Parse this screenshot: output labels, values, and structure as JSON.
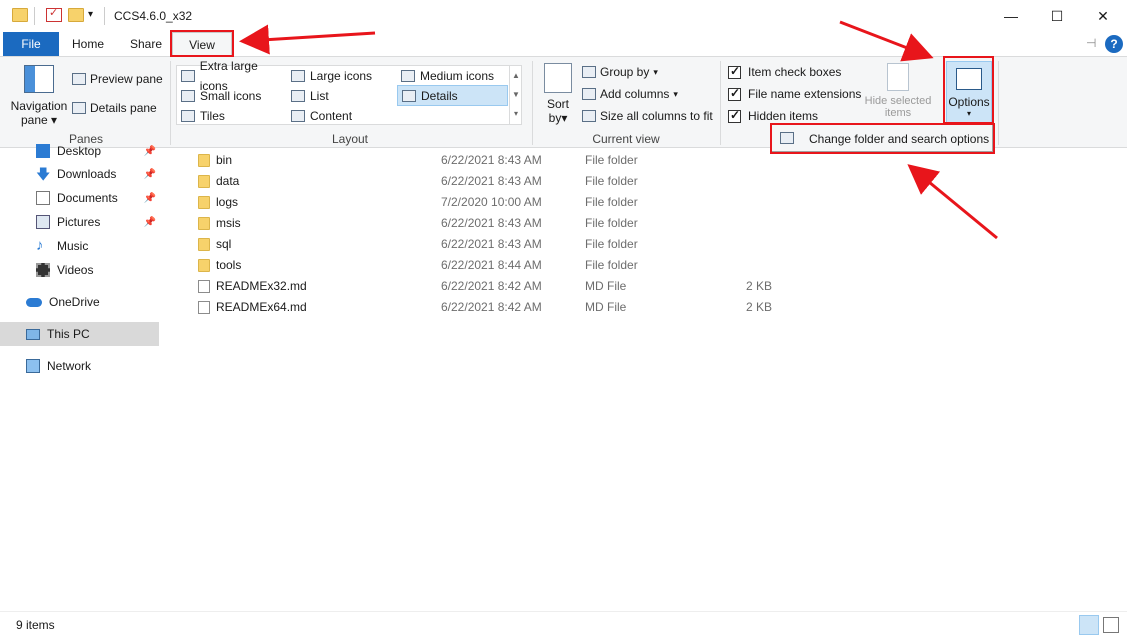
{
  "window": {
    "title": "CCS4.6.0_x32",
    "controls": {
      "minimize": "—",
      "maximize": "☐",
      "close": "✕"
    }
  },
  "tabs": {
    "file": "File",
    "home": "Home",
    "share": "Share",
    "view": "View"
  },
  "ribbon": {
    "panes": {
      "label": "Panes",
      "navigation_pane": "Navigation",
      "navigation_pane_line2": "pane",
      "preview_pane": "Preview pane",
      "details_pane": "Details pane"
    },
    "layout": {
      "label": "Layout",
      "items": [
        "Extra large icons",
        "Large icons",
        "Medium icons",
        "Small icons",
        "List",
        "Details",
        "Tiles",
        "Content"
      ],
      "selected": "Details"
    },
    "current_view": {
      "label": "Current view",
      "sort_by": "Sort",
      "sort_by_line2": "by",
      "group_by": "Group by",
      "add_columns": "Add columns",
      "size_all_columns": "Size all columns to fit"
    },
    "show_hide": {
      "item_check_boxes": "Item check boxes",
      "file_name_extensions": "File name extensions",
      "hidden_items": "Hidden items",
      "hide_selected_items": "Hide selected",
      "hide_selected_items_line2": "items"
    },
    "options": "Options"
  },
  "dropdown": {
    "change_folder_options": "Change folder and search options"
  },
  "nav": {
    "items": [
      {
        "label": "Desktop",
        "icon": "desktop-icon",
        "pinned": true
      },
      {
        "label": "Downloads",
        "icon": "download-icon",
        "pinned": true
      },
      {
        "label": "Documents",
        "icon": "documents-icon",
        "pinned": true
      },
      {
        "label": "Pictures",
        "icon": "pictures-icon",
        "pinned": true
      },
      {
        "label": "Music",
        "icon": "music-icon",
        "pinned": false
      },
      {
        "label": "Videos",
        "icon": "videos-icon",
        "pinned": false
      }
    ],
    "onedrive": "OneDrive",
    "this_pc": "This PC",
    "network": "Network"
  },
  "files": [
    {
      "name": "bin",
      "date": "6/22/2021 8:43 AM",
      "type": "File folder",
      "size": ""
    },
    {
      "name": "data",
      "date": "6/22/2021 8:43 AM",
      "type": "File folder",
      "size": ""
    },
    {
      "name": "logs",
      "date": "7/2/2020 10:00 AM",
      "type": "File folder",
      "size": ""
    },
    {
      "name": "msis",
      "date": "6/22/2021 8:43 AM",
      "type": "File folder",
      "size": ""
    },
    {
      "name": "sql",
      "date": "6/22/2021 8:43 AM",
      "type": "File folder",
      "size": ""
    },
    {
      "name": "tools",
      "date": "6/22/2021 8:44 AM",
      "type": "File folder",
      "size": ""
    },
    {
      "name": "READMEx32.md",
      "date": "6/22/2021 8:42 AM",
      "type": "MD File",
      "size": "2 KB"
    },
    {
      "name": "READMEx64.md",
      "date": "6/22/2021 8:42 AM",
      "type": "MD File",
      "size": "2 KB"
    }
  ],
  "status": {
    "item_count": "9 items"
  },
  "colors": {
    "accent": "#1b6ac0",
    "annotation": "#e8151b",
    "selection": "#cce4f7"
  }
}
